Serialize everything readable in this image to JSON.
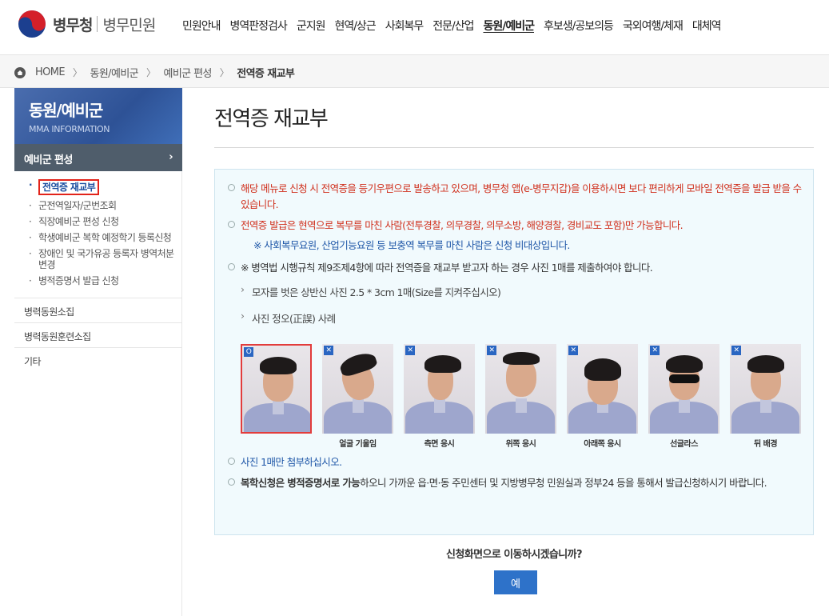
{
  "header": {
    "logo_name": "병무청",
    "logo_sub": "병무민원",
    "nav": [
      "민원안내",
      "병역판정검사",
      "군지원",
      "현역/상근",
      "사회복무",
      "전문/산업",
      "동원/예비군",
      "후보생/공보의등",
      "국외여행/체재",
      "대체역"
    ],
    "active_nav_index": 6
  },
  "breadcrumb": {
    "home": "HOME",
    "items": [
      "동원/예비군",
      "예비군 편성",
      "전역증 재교부"
    ]
  },
  "sidebar": {
    "title": "동원/예비군",
    "subtitle": "MMA INFORMATION",
    "selected_section": "예비군 편성",
    "sub_items": [
      "전역증 재교부",
      "군전역일자/군번조회",
      "직장예비군 편성 신청",
      "학생예비군 복학 예정학기 등록신청",
      "장애인 및 국가유공 등록자 병역처분변경",
      "병적증명서 발급 신청"
    ],
    "current_sub_index": 0,
    "menu": [
      "병력동원소집",
      "병력동원훈련소집",
      "기타"
    ]
  },
  "main": {
    "title": "전역증 재교부",
    "info1": "해당 메뉴로 신청 시 전역증을 등기우편으로 발송하고 있으며, 병무청 앱(e-병무지갑)을 이용하시면 보다 편리하게 모바일 전역증을 발급 받을 수 있습니다.",
    "info2": "전역증 발급은 현역으로 복무를 마친 사람(전투경찰, 의무경찰, 의무소방, 해양경찰, 경비교도 포함)만 가능합니다.",
    "info2_note": "※ 사회복무요원, 산업기능요원 등 보충역 복무를 마친 사람은 신청 비대상입니다.",
    "info3": "※ 병역법 시행규칙 제9조제4항에 따라 전역증을 재교부 받고자 하는 경우 사진 1매를 제출하여야 합니다.",
    "sub1": "모자를 벗은 상반신 사진 2.5 * 3cm 1매(Size를 지켜주십시오)",
    "sub2": "사진 정오(正誤) 사례",
    "photos": [
      {
        "mark": "O",
        "caption": ""
      },
      {
        "mark": "✕",
        "caption": "얼굴 기울임"
      },
      {
        "mark": "✕",
        "caption": "측면 응시"
      },
      {
        "mark": "✕",
        "caption": "위쪽 응시"
      },
      {
        "mark": "✕",
        "caption": "아래쪽 응시"
      },
      {
        "mark": "✕",
        "caption": "선글라스"
      },
      {
        "mark": "✕",
        "caption": "뒤 배경"
      }
    ],
    "info4": "사진 1매만 첨부하십시오.",
    "info5_bold": "복학신청은 병적증명서로 가능",
    "info5_rest": "하오니 가까운 읍·면·동 주민센터 및 지방병무청 민원실과 정부24 등을 통해서 발급신청하시기 바랍니다.",
    "confirm_text": "신청화면으로 이동하시겠습니까?",
    "yes_label": "예"
  }
}
